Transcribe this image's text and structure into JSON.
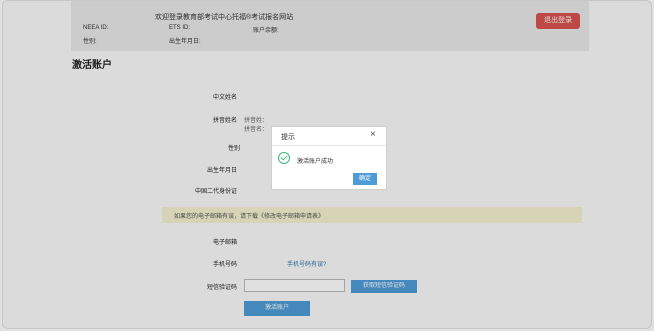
{
  "header": {
    "welcome": "欢迎登录教育部考试中心托福®考试报名网站",
    "logout_label": "退出登录",
    "neea_id_label": "NEEA ID:",
    "ets_id_label": "ETS ID:",
    "balance_label": "账户余额:",
    "gender_label": "性别:",
    "dob_label": "出生年月日:"
  },
  "page": {
    "title": "激活账户"
  },
  "form": {
    "chinese_name_label": "中文姓名",
    "pinyin_name_label": "拼音姓名",
    "pinyin_surname_label": "拼音姓：",
    "pinyin_given_label": "拼音名：",
    "gender_label": "性别",
    "dob_label": "出生年月日",
    "id_card_label": "中国二代身份证",
    "notice": "如果您的电子邮箱有误，请下载《修改电子邮箱申请表》",
    "email_label": "电子邮箱",
    "phone_label": "手机号码",
    "phone_link": "手机号码有误?",
    "sms_label": "短信验证码",
    "sms_button": "获取短信验证码",
    "submit_button": "激活账户"
  },
  "dialog": {
    "title": "提示",
    "close_icon": "close-icon",
    "status_icon": "check-circle-icon",
    "message": "激活账户成功",
    "ok_label": "确定"
  },
  "colors": {
    "primary": "#4f9bd6",
    "danger": "#d9534f",
    "success": "#3cb878",
    "notice_bg": "#f5f1d0"
  }
}
